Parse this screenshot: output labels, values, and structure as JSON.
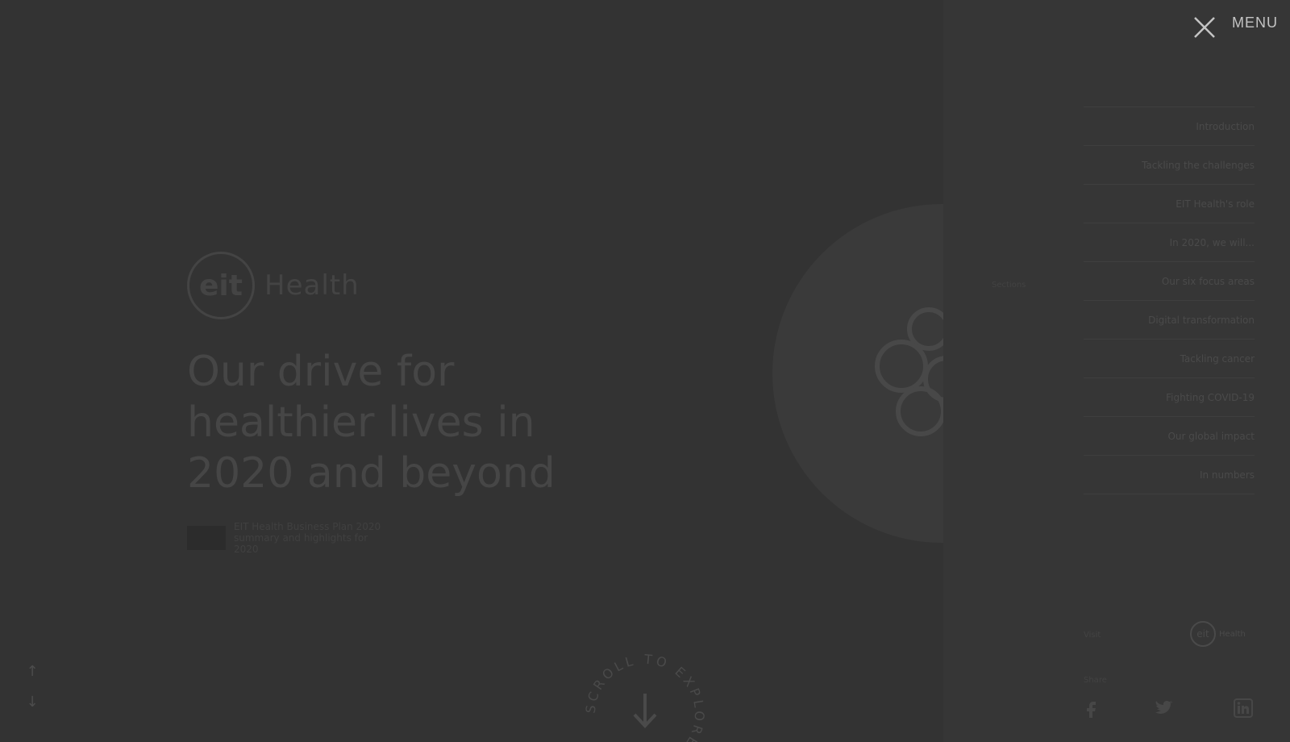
{
  "hero": {
    "logo_mark": "eit",
    "logo_word": "Health",
    "headline": "Our drive for healthier lives in 2020 and beyond",
    "subtitle": "EIT Health Business Plan 2020 summary and highlights for 2020",
    "scroll_badge_text": "SCROLL TO EXPLORE",
    "up_icon": "arrow-up-icon",
    "down_icon": "arrow-down-icon"
  },
  "menu": {
    "label": "MENU",
    "close_icon": "close-icon",
    "items": [
      {
        "label": "Introduction"
      },
      {
        "label": "Tackling the challenges"
      },
      {
        "label": "EIT Health's role"
      },
      {
        "label": "In 2020, we will..."
      },
      {
        "label": "Our six focus areas"
      },
      {
        "label": "Digital transformation"
      },
      {
        "label": "Tackling cancer"
      },
      {
        "label": "Fighting COVID-19"
      },
      {
        "label": "Our global impact"
      },
      {
        "label": "In numbers"
      }
    ],
    "section_label": "Sections",
    "visit_label": "Visit",
    "visit_logo_mark": "eit",
    "visit_logo_word": "Health",
    "share_label": "Share",
    "social": [
      "facebook-icon",
      "twitter-icon",
      "linkedin-icon"
    ]
  },
  "colors": {
    "overlay": "#333333",
    "panel": "#363636",
    "menu_label": "#c4c4c4"
  }
}
